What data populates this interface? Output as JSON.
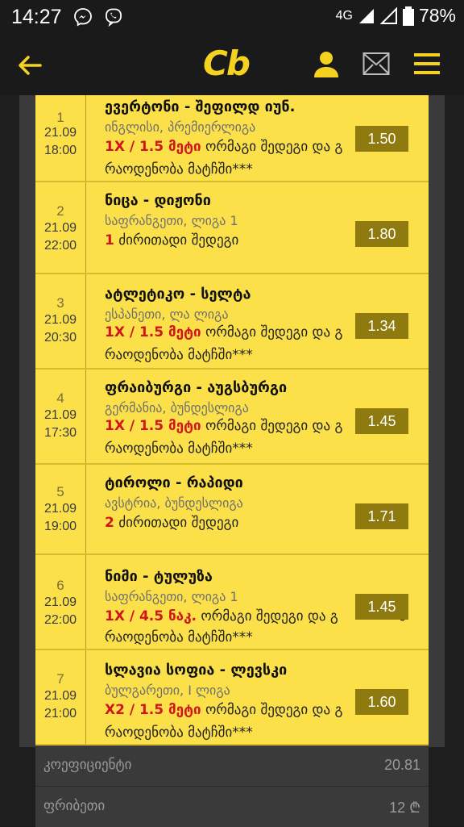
{
  "status": {
    "time": "14:27",
    "network": "4G",
    "battery": "78%"
  },
  "appbar": {
    "logo": "Cb"
  },
  "matches": [
    {
      "num": "1",
      "date": "21.09",
      "time": "18:00",
      "teams": "ევერტონი - შეფილდ იუნ.",
      "league": "ინგლისი, პრემიერლიგა",
      "code": "1X / 1.5 მეტი",
      "bet": "ორმაგი შედეგი და გ",
      "bet_end": "ს",
      "bet2": "რაოდენობა მატჩში***",
      "odds": "1.50"
    },
    {
      "num": "2",
      "date": "21.09",
      "time": "22:00",
      "teams": "ნიცა - დიჟონი",
      "league": "საფრანგეთი, ლიგა 1",
      "code": "1",
      "bet": "ძირითადი შედეგი",
      "bet_end": "",
      "bet2": "",
      "odds": "1.80"
    },
    {
      "num": "3",
      "date": "21.09",
      "time": "20:30",
      "teams": "ატლეტიკო - სელტა",
      "league": "ესპანეთი, ლა ლიგა",
      "code": "1X / 1.5 მეტი",
      "bet": "ორმაგი შედეგი და გ",
      "bet_end": "ს",
      "bet2": "რაოდენობა მატჩში***",
      "odds": "1.34"
    },
    {
      "num": "4",
      "date": "21.09",
      "time": "17:30",
      "teams": "ფრაიბურგი - აუგსბურგი",
      "league": "გერმანია, ბუნდესლიგა",
      "code": "1X / 1.5 მეტი",
      "bet": "ორმაგი შედეგი და გ",
      "bet_end": "ს",
      "bet2": "რაოდენობა მატჩში***",
      "odds": "1.45"
    },
    {
      "num": "5",
      "date": "21.09",
      "time": "19:00",
      "teams": "ტიროლი - რაპიდი",
      "league": "ავსტრია, ბუნდესლიგა",
      "code": "2",
      "bet": "ძირითადი შედეგი",
      "bet_end": "",
      "bet2": "",
      "odds": "1.71"
    },
    {
      "num": "6",
      "date": "21.09",
      "time": "22:00",
      "teams": "ნიმი - ტულუზა",
      "league": "საფრანგეთი, ლიგა 1",
      "code": "1X / 4.5 ნაკ.",
      "bet": "ორმაგი შედეგი და გ",
      "bet_end": "ს",
      "bet2": "რაოდენობა მატჩში***",
      "odds": "1.45"
    },
    {
      "num": "7",
      "date": "21.09",
      "time": "21:00",
      "teams": "სლავია სოფია - ლევსკი",
      "league": "ბულგარეთი, I ლიგა",
      "code": "X2 / 1.5 მეტი",
      "bet": "ორმაგი შედეგი და გ",
      "bet_end": "ს",
      "bet2": "რაოდენობა მატჩში***",
      "odds": "1.60"
    }
  ],
  "summary": {
    "coef_label": "კოეფიციენტი",
    "coef_value": "20.81",
    "stake_label": "ფრიბეთი",
    "stake_value": "12 ₾"
  },
  "colors": {
    "accent": "#f5d21f",
    "row_bg": "#fbe04a",
    "odds_bg": "#8f7a10",
    "code_red": "#d0161b"
  }
}
